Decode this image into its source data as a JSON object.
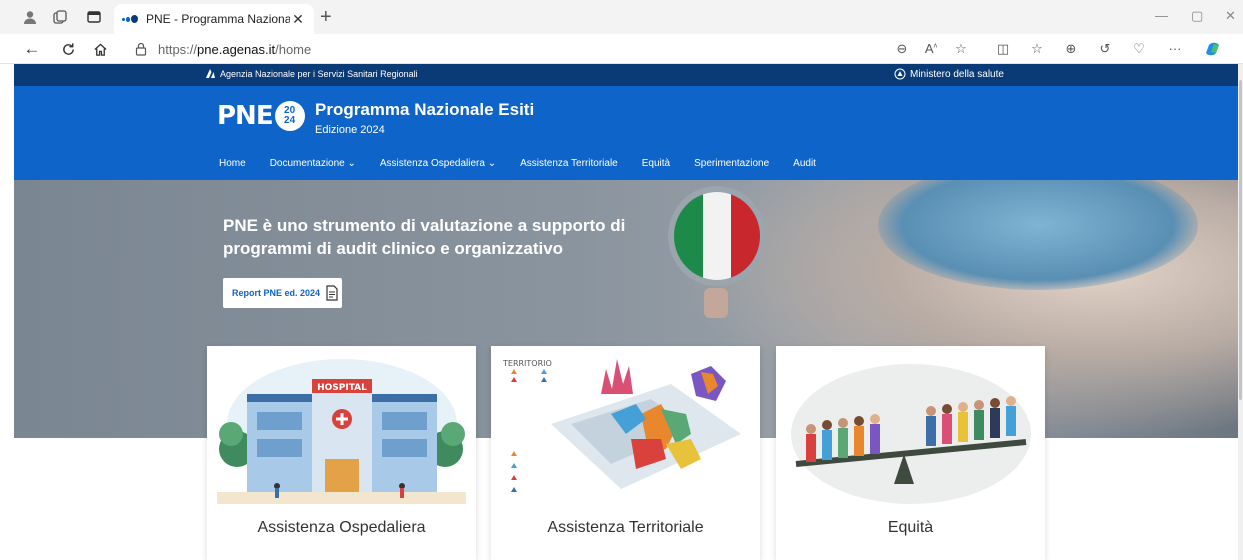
{
  "browser": {
    "tab": {
      "title": "PNE - Programma Nazionale Esiti",
      "close_icon": "close-icon"
    },
    "address": {
      "url_prefix": "https://",
      "url_host": "pne.agenas.it",
      "url_path": "/home"
    }
  },
  "site": {
    "topbar": {
      "agency": "Agenzia Nazionale per i Servizi Sanitari Regionali",
      "ministry": "Ministero della salute"
    },
    "header": {
      "logo_text": "PNE",
      "logo_badge_top": "20",
      "logo_badge_bottom": "24",
      "title": "Programma Nazionale Esiti",
      "subtitle": "Edizione 2024"
    },
    "menu": [
      {
        "label": "Home"
      },
      {
        "label": "Documentazione ⌄"
      },
      {
        "label": "Assistenza Ospedaliera ⌄"
      },
      {
        "label": "Assistenza Territoriale"
      },
      {
        "label": "Equità"
      },
      {
        "label": "Sperimentazione"
      },
      {
        "label": "Audit"
      }
    ],
    "hero": {
      "heading": "PNE è uno strumento di valutazione a supporto di programmi di audit clinico e organizzativo",
      "button": "Report PNE ed. 2024"
    },
    "cards": [
      {
        "title": "Assistenza Ospedaliera",
        "img_label": "HOSPITAL"
      },
      {
        "title": "Assistenza Territoriale",
        "img_label": "TERRITORIO"
      },
      {
        "title": "Equità"
      }
    ]
  },
  "colors": {
    "header_blue": "#0e64c8",
    "top_strip": "#0a3b77",
    "flag_green": "#1e8a4a",
    "flag_white": "#f2f2f2",
    "flag_red": "#c8282d"
  }
}
